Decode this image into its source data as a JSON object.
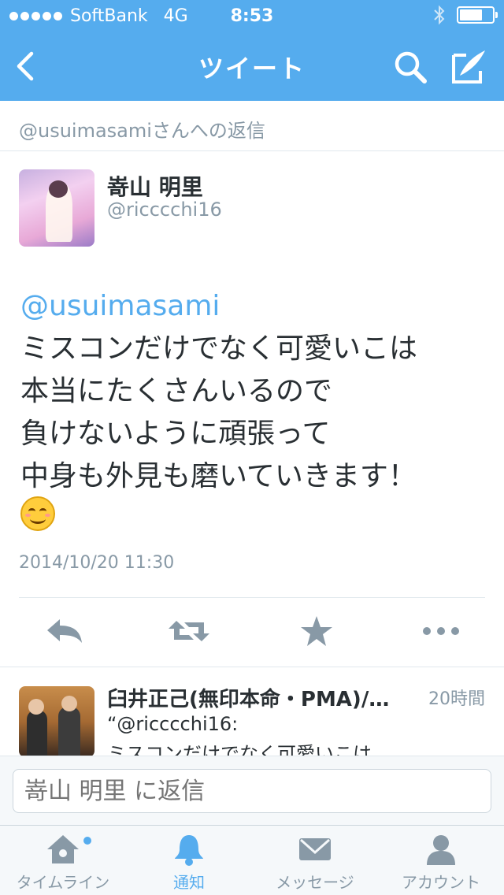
{
  "status_bar": {
    "carrier": "SoftBank",
    "network": "4G",
    "time": "8:53"
  },
  "nav": {
    "title": "ツイート"
  },
  "reply_context": "@usuimasamiさんへの返信",
  "tweet": {
    "name": "嵜山 明里",
    "handle": "@ricccchi16",
    "mention": "@usuimasami",
    "lines": [
      "ミスコンだけでなく可愛いこは",
      "本当にたくさんいるので",
      "負けないように頑張って",
      "中身も外見も磨いていきます！"
    ],
    "emoji": "smiling-face",
    "timestamp": "2014/10/20 11:30"
  },
  "reply": {
    "name": "臼井正己(無印本命・PMA)/…",
    "time": "20時間",
    "line1": "“@ricccchi16:",
    "line2": "ミスコンだけでなく可愛いこは"
  },
  "compose": {
    "placeholder": "嵜山 明里 に返信"
  },
  "tabs": [
    {
      "label": "タイムライン",
      "icon": "home-icon"
    },
    {
      "label": "通知",
      "icon": "bell-icon"
    },
    {
      "label": "メッセージ",
      "icon": "envelope-icon"
    },
    {
      "label": "アカウント",
      "icon": "person-icon"
    }
  ],
  "colors": {
    "accent": "#55acee",
    "text": "#292f33",
    "muted": "#8899a6",
    "action_icon": "#8899a6"
  }
}
